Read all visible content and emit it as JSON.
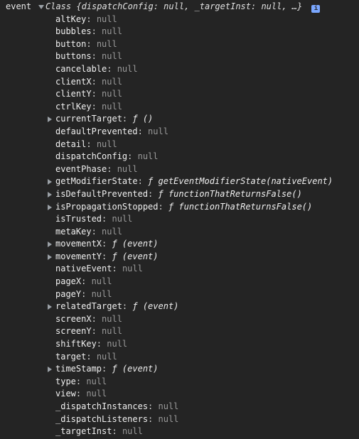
{
  "header": {
    "key": "event",
    "summary_class": "Class",
    "summary_body": "{dispatchConfig: null, _targetInst: null, …}",
    "badge": "i"
  },
  "properties": [
    {
      "key": "altKey",
      "value": "null",
      "kind": "null",
      "expandable": false
    },
    {
      "key": "bubbles",
      "value": "null",
      "kind": "null",
      "expandable": false
    },
    {
      "key": "button",
      "value": "null",
      "kind": "null",
      "expandable": false
    },
    {
      "key": "buttons",
      "value": "null",
      "kind": "null",
      "expandable": false
    },
    {
      "key": "cancelable",
      "value": "null",
      "kind": "null",
      "expandable": false
    },
    {
      "key": "clientX",
      "value": "null",
      "kind": "null",
      "expandable": false
    },
    {
      "key": "clientY",
      "value": "null",
      "kind": "null",
      "expandable": false
    },
    {
      "key": "ctrlKey",
      "value": "null",
      "kind": "null",
      "expandable": false
    },
    {
      "key": "currentTarget",
      "value": "ƒ ()",
      "kind": "fn",
      "expandable": true
    },
    {
      "key": "defaultPrevented",
      "value": "null",
      "kind": "null",
      "expandable": false
    },
    {
      "key": "detail",
      "value": "null",
      "kind": "null",
      "expandable": false
    },
    {
      "key": "dispatchConfig",
      "value": "null",
      "kind": "null",
      "expandable": false
    },
    {
      "key": "eventPhase",
      "value": "null",
      "kind": "null",
      "expandable": false
    },
    {
      "key": "getModifierState",
      "value": "ƒ getEventModifierState(nativeEvent)",
      "kind": "fn",
      "expandable": true
    },
    {
      "key": "isDefaultPrevented",
      "value": "ƒ functionThatReturnsFalse()",
      "kind": "fn",
      "expandable": true
    },
    {
      "key": "isPropagationStopped",
      "value": "ƒ functionThatReturnsFalse()",
      "kind": "fn",
      "expandable": true
    },
    {
      "key": "isTrusted",
      "value": "null",
      "kind": "null",
      "expandable": false
    },
    {
      "key": "metaKey",
      "value": "null",
      "kind": "null",
      "expandable": false
    },
    {
      "key": "movementX",
      "value": "ƒ (event)",
      "kind": "fn",
      "expandable": true
    },
    {
      "key": "movementY",
      "value": "ƒ (event)",
      "kind": "fn",
      "expandable": true
    },
    {
      "key": "nativeEvent",
      "value": "null",
      "kind": "null",
      "expandable": false
    },
    {
      "key": "pageX",
      "value": "null",
      "kind": "null",
      "expandable": false
    },
    {
      "key": "pageY",
      "value": "null",
      "kind": "null",
      "expandable": false
    },
    {
      "key": "relatedTarget",
      "value": "ƒ (event)",
      "kind": "fn",
      "expandable": true
    },
    {
      "key": "screenX",
      "value": "null",
      "kind": "null",
      "expandable": false
    },
    {
      "key": "screenY",
      "value": "null",
      "kind": "null",
      "expandable": false
    },
    {
      "key": "shiftKey",
      "value": "null",
      "kind": "null",
      "expandable": false
    },
    {
      "key": "target",
      "value": "null",
      "kind": "null",
      "expandable": false
    },
    {
      "key": "timeStamp",
      "value": "ƒ (event)",
      "kind": "fn",
      "expandable": true
    },
    {
      "key": "type",
      "value": "null",
      "kind": "null",
      "expandable": false
    },
    {
      "key": "view",
      "value": "null",
      "kind": "null",
      "expandable": false
    },
    {
      "key": "_dispatchInstances",
      "value": "null",
      "kind": "null",
      "expandable": false
    },
    {
      "key": "_dispatchListeners",
      "value": "null",
      "kind": "null",
      "expandable": false
    },
    {
      "key": "_targetInst",
      "value": "null",
      "kind": "null",
      "expandable": false
    }
  ],
  "colors": {
    "background": "#242424",
    "key": "#f0f0f0",
    "null": "#9a9a9a",
    "badge": "#7aa7ff"
  }
}
